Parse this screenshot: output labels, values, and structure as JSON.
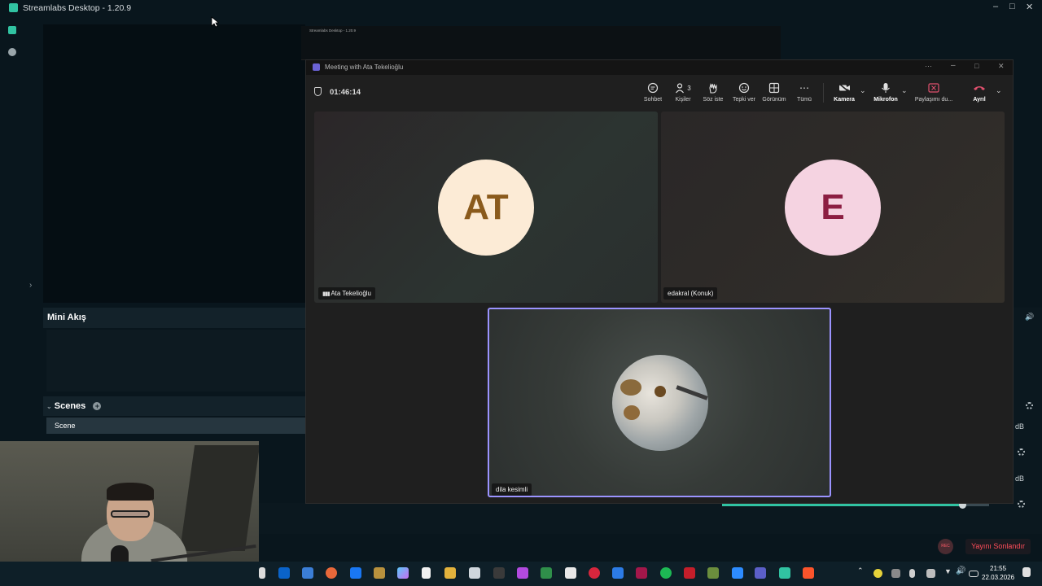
{
  "app": {
    "title": "Streamlabs Desktop - 1.20.9"
  },
  "panels": {
    "mini_stream": "Mini Akış",
    "scenes": "Scenes",
    "scene_item": "Scene",
    "db1": "dB",
    "db2": "dB",
    "stop_stream": "Yayını Sonlandır",
    "rec": "REC",
    "volume_level": 0.9
  },
  "nested_preview": {
    "title": "Streamlabs Desktop - 1.20.9"
  },
  "teams": {
    "window_title": "Meeting with Ata Tekelioğlu",
    "timer": "01:46:14",
    "toolbar": {
      "chat": "Sohbet",
      "people": "Kişiler",
      "people_count": "3",
      "raise": "Söz iste",
      "react": "Tepki ver",
      "view": "Görünüm",
      "more": "Tümü",
      "camera": "Kamera",
      "mic": "Mikrofon",
      "share": "Paylaşımı du...",
      "leave": "Ayrıl"
    },
    "participants": [
      {
        "initials": "AT",
        "name": "Ata Tekelioğlu",
        "avatar_bg": "#fcebd6",
        "avatar_fg": "#8a5a1c"
      },
      {
        "initials": "E",
        "name": "edakral (Konuk)",
        "avatar_bg": "#f5d3e1",
        "avatar_fg": "#8c1e42"
      },
      {
        "initials": "",
        "name": "dila kesimli"
      }
    ]
  },
  "taskbar": {
    "time": "21:55",
    "date": "22.03.2026"
  },
  "colors": {
    "accent": "#31c3a2",
    "speaker_border": "#9b93ff",
    "leave": "#e0506e"
  }
}
